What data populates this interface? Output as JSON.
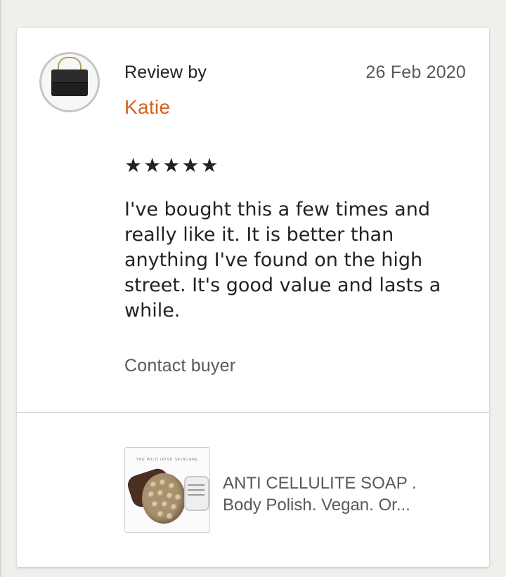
{
  "review": {
    "by_label": "Review by",
    "date": "26 Feb 2020",
    "reviewer_name": "Katie",
    "rating": 5,
    "stars": [
      "★",
      "★",
      "★",
      "★",
      "★"
    ],
    "text": "I've bought this a few times and really like it. It is better than anything I've found on the high street. It's good value and lasts a while.",
    "contact_label": "Contact buyer"
  },
  "avatar": {
    "icon": "handbag-avatar-icon"
  },
  "product": {
    "thumb_brand": "THE WILD IRISH SKINCARE",
    "title_line1": "ANTI CELLULITE SOAP .",
    "title_line2": "Body Polish. Vegan.  Or..."
  },
  "colors": {
    "reviewer_name": "#d5641c",
    "text_primary": "#222222",
    "text_secondary": "#595959",
    "card_background": "#ffffff",
    "page_background": "#f0efec"
  }
}
